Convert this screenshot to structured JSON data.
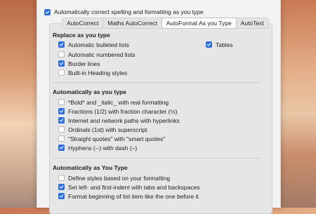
{
  "top_checkbox": {
    "label": "Automatically correct spelling and formatting as you type",
    "checked": true
  },
  "tabs": [
    {
      "label": "AutoCorrect",
      "active": false
    },
    {
      "label": "Maths AutoCorrect",
      "active": false
    },
    {
      "label": "AutoFormat As you Type",
      "active": true
    },
    {
      "label": "AutoText",
      "active": false
    }
  ],
  "replace_section": {
    "title": "Replace as you type",
    "items": [
      {
        "label": "Automatic bulleted lists",
        "checked": true
      },
      {
        "label": "Automatic numbered lists",
        "checked": false
      },
      {
        "label": "Border lines",
        "checked": true
      },
      {
        "label": "Built-in Heading styles",
        "checked": false
      }
    ],
    "right_items": [
      {
        "label": "Tables",
        "checked": true
      }
    ]
  },
  "auto_section": {
    "title": "Automatically as you type",
    "items": [
      {
        "label": "*Bold* and _italic_ with real formatting",
        "checked": false
      },
      {
        "label": "Fractions (1/2) with fraction character (½)",
        "checked": true
      },
      {
        "label": "Internet and network paths with hyperlinks",
        "checked": true
      },
      {
        "label": "Ordinals (1st) with superscript",
        "checked": false
      },
      {
        "label": "\"Straight quotes\" with \"smart quotes\"",
        "checked": false
      },
      {
        "label": "Hyphens (--) with dash (–)",
        "checked": true
      }
    ]
  },
  "auto_type_section": {
    "title": "Automatically as You Type",
    "items": [
      {
        "label": "Define styles based on your formatting",
        "checked": false
      },
      {
        "label": "Set left- and first-indent with tabs and backspaces",
        "checked": true
      },
      {
        "label": "Format beginning of list item like the one before it",
        "checked": true
      }
    ]
  }
}
